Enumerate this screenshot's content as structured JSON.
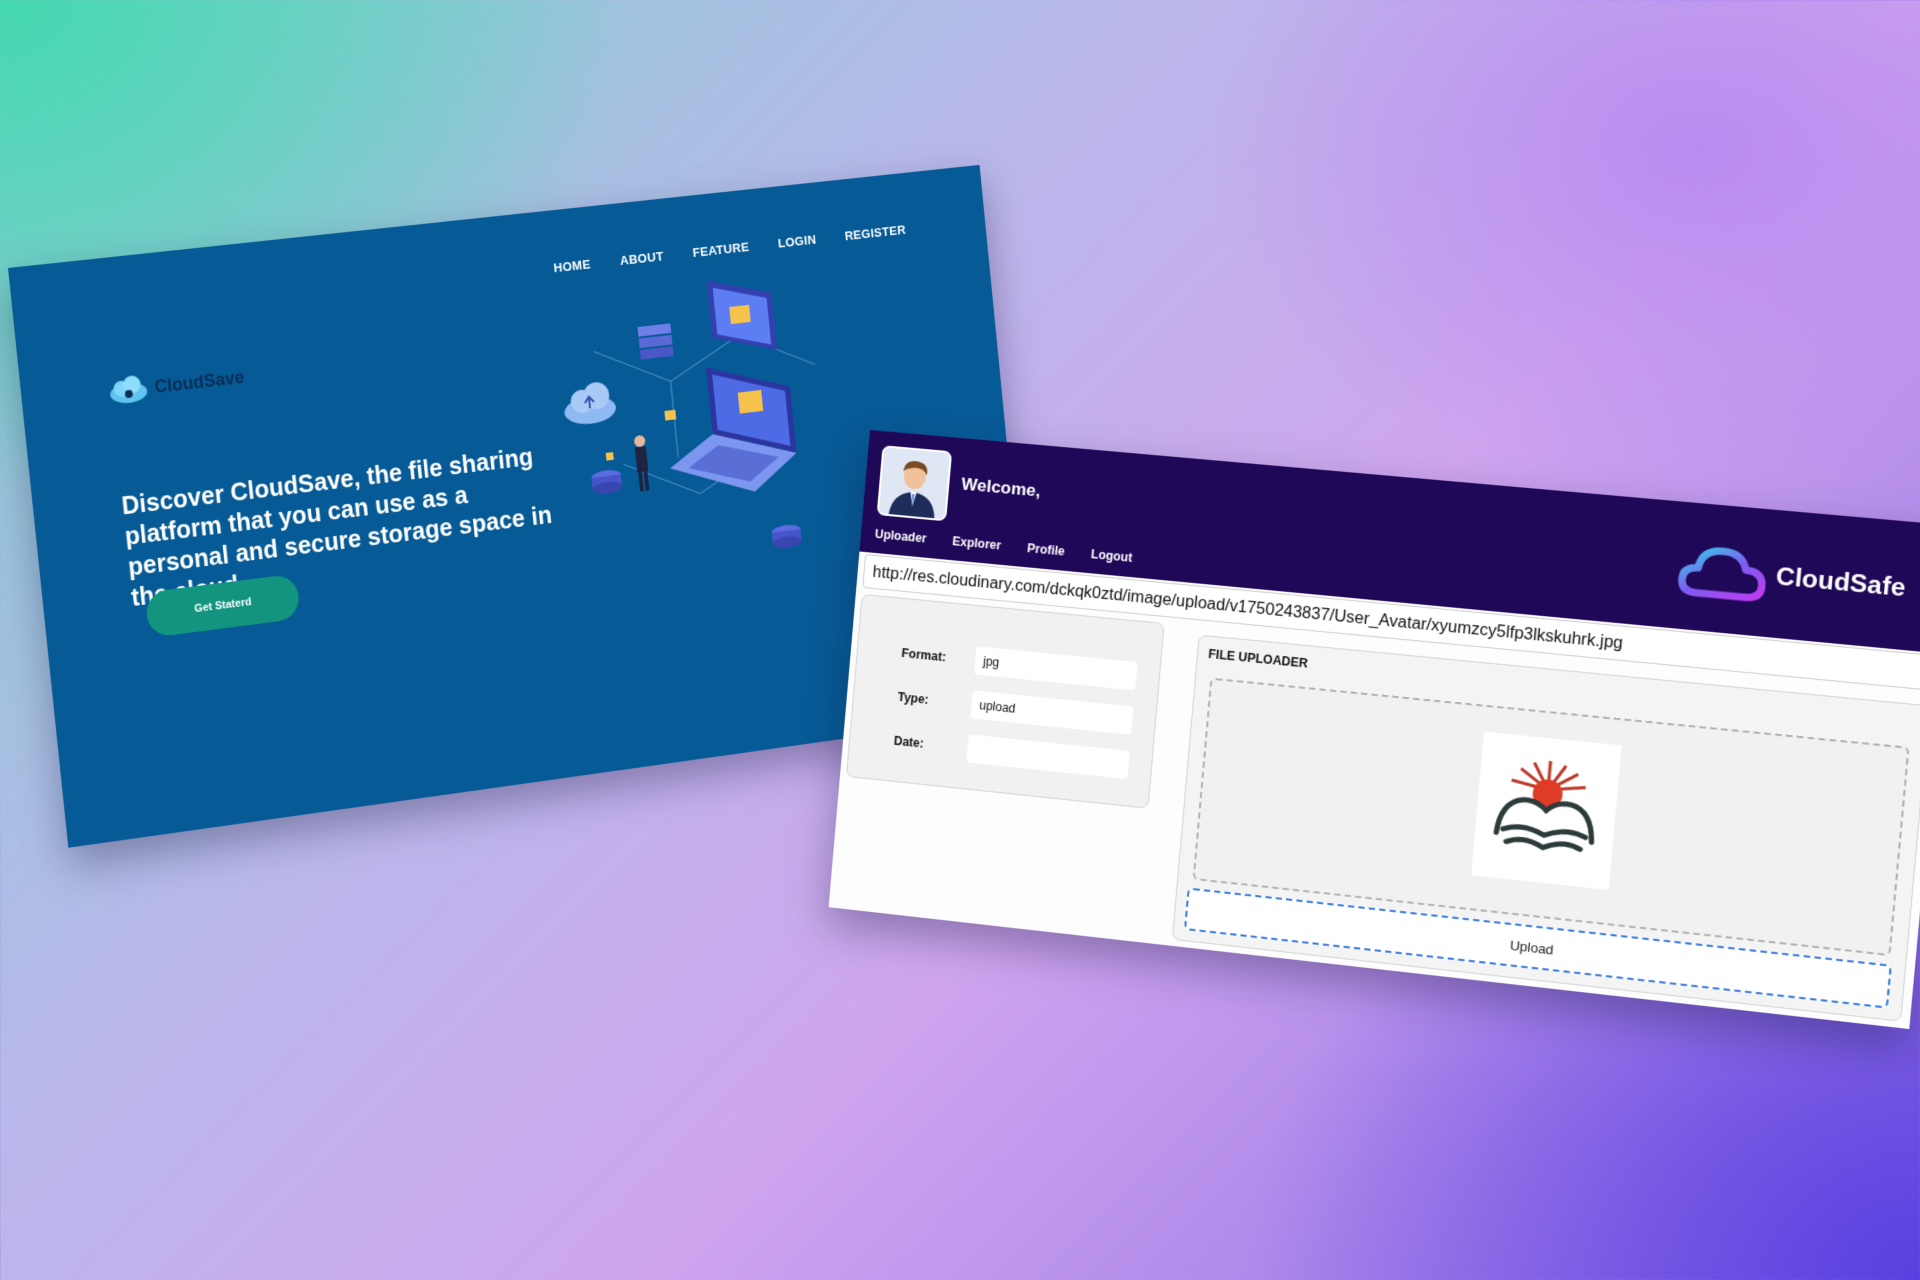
{
  "landing": {
    "brand": "CloudSave",
    "nav": [
      "HOME",
      "ABOUT",
      "FEATURE",
      "LOGIN",
      "REGISTER"
    ],
    "headline": "Discover CloudSave, the file sharing platform that you can use as a personal and secure storage space in the cloud",
    "cta": "Get Staterd",
    "colors": {
      "background": "#065a96",
      "cta": "#13947f"
    }
  },
  "app": {
    "welcome": "Welcome,",
    "tabs": [
      "Uploader",
      "Explorer",
      "Profile",
      "Logout"
    ],
    "brand": "CloudSafe",
    "url": "http://res.cloudinary.com/dckqk0ztd/image/upload/v1750243837/User_Avatar/xyumzcy5lfp3lkskuhrk.jpg",
    "details": {
      "format_label": "Format:",
      "format_value": "jpg",
      "type_label": "Type:",
      "type_value": "upload",
      "date_label": "Date:",
      "date_value": ""
    },
    "uploader": {
      "title": "FILE UPLOADER",
      "button": "Upload"
    },
    "colors": {
      "header": "#1f0858",
      "upload_border": "#3d7ee0"
    }
  }
}
